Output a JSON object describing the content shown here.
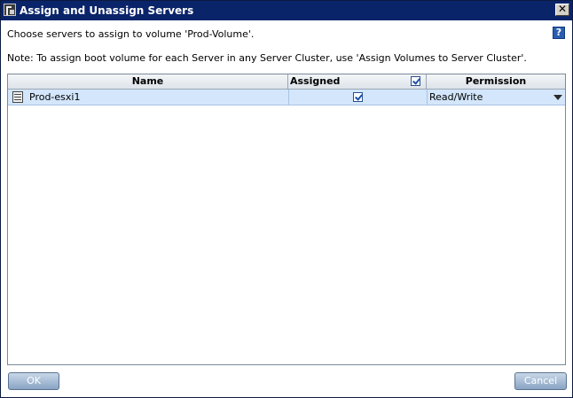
{
  "window": {
    "title": "Assign and Unassign Servers",
    "close_label": "✕"
  },
  "prompt": "Choose servers to assign to volume 'Prod-Volume'.",
  "help_label": "?",
  "note": "Note: To assign boot volume for each Server in any Server Cluster, use 'Assign Volumes to Server Cluster'.",
  "table": {
    "columns": [
      "Name",
      "Assigned",
      "Permission"
    ],
    "header_assigned_all_checked": true,
    "rows": [
      {
        "name": "Prod-esxi1",
        "assigned": true,
        "permission": "Read/Write"
      }
    ]
  },
  "buttons": {
    "ok": "OK",
    "cancel": "Cancel"
  },
  "colors": {
    "titlebar": "#0a246a",
    "selected_row": "#d3e6fb",
    "button": "#8aa4c4"
  }
}
